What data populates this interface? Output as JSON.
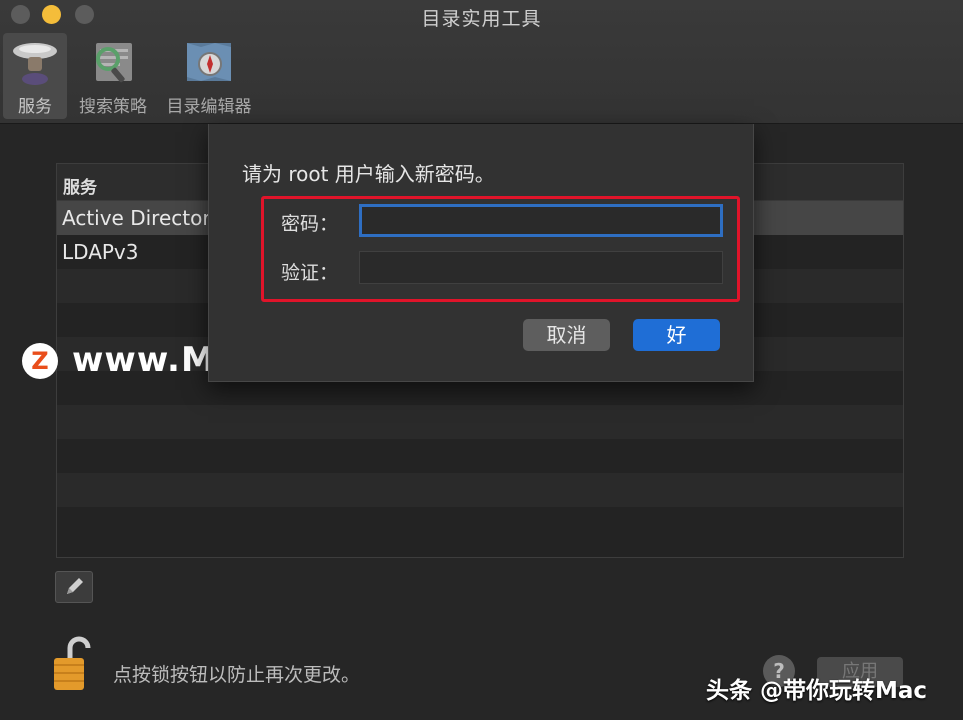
{
  "window": {
    "title": "目录实用工具",
    "colors": {
      "accent": "#1f6ed6",
      "highlight": "#e0142a",
      "minimize": "#f4bd3a"
    }
  },
  "toolbar": {
    "items": [
      {
        "label": "服务",
        "icon": "services-icon",
        "selected": true
      },
      {
        "label": "搜索策略",
        "icon": "search-policy-icon",
        "selected": false
      },
      {
        "label": "目录编辑器",
        "icon": "directory-editor-icon",
        "selected": false
      }
    ]
  },
  "table": {
    "header": "服务",
    "rows": [
      "Active Directory",
      "LDAPv3"
    ]
  },
  "dialog": {
    "message": "请为 root 用户输入新密码。",
    "password_label": "密码：",
    "verify_label": "验证：",
    "password_value": "",
    "verify_value": "",
    "cancel_label": "取消",
    "ok_label": "好"
  },
  "footer": {
    "lock_text": "点按锁按钮以防止再次更改。",
    "help_label": "?",
    "apply_label": "应用"
  },
  "overlay": {
    "watermark_badge": "Z",
    "watermark_text": "www.MacZ.com",
    "brand_text": "头条 @带你玩转Mac"
  }
}
